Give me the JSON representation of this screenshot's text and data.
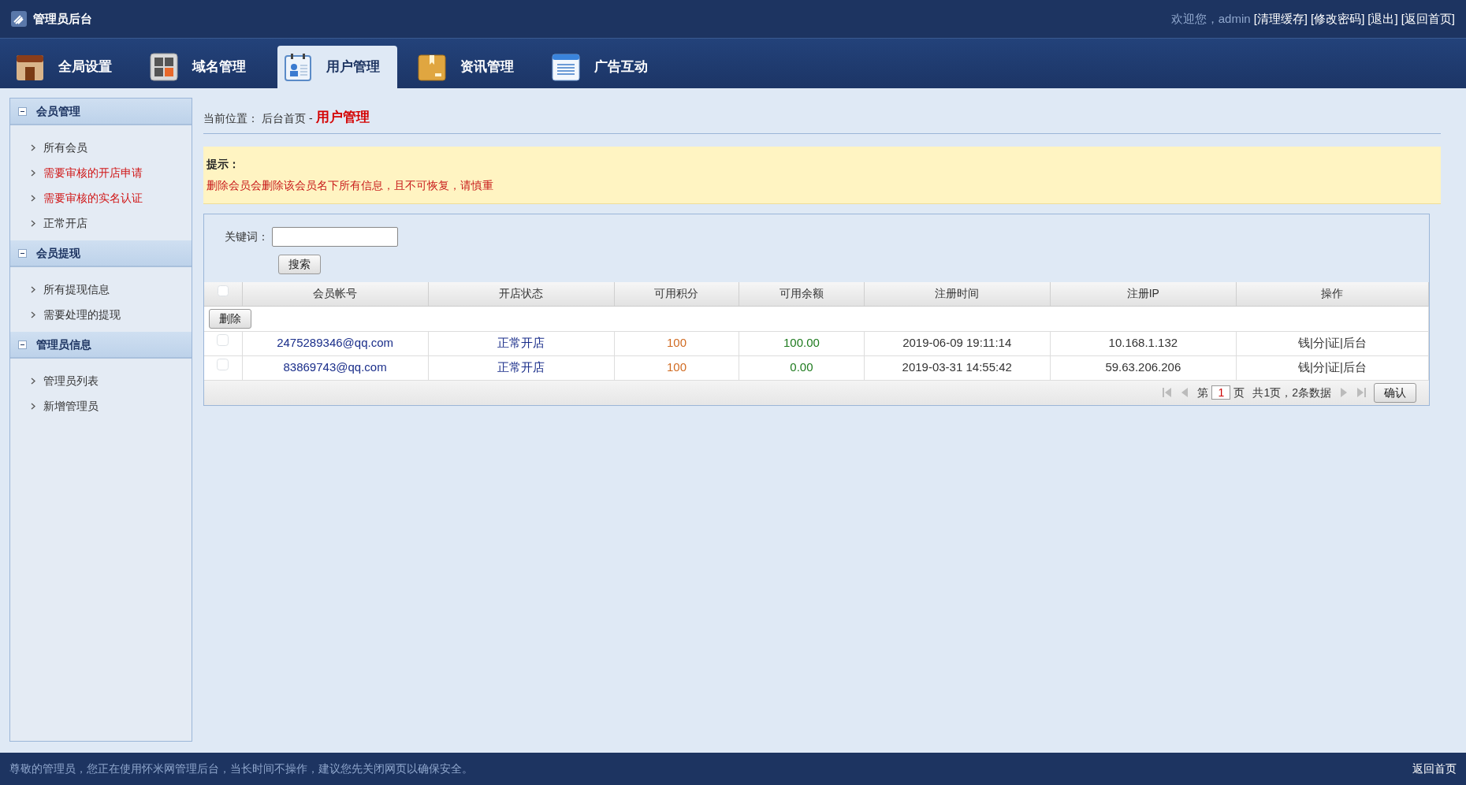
{
  "header": {
    "title": "管理员后台",
    "welcome": "欢迎您，admin",
    "links": [
      "[清理缓存]",
      "[修改密码]",
      "[退出]",
      "[返回首页]"
    ]
  },
  "tabs": [
    {
      "label": "全局设置",
      "selected": false
    },
    {
      "label": "域名管理",
      "selected": false
    },
    {
      "label": "用户管理",
      "selected": true
    },
    {
      "label": "资讯管理",
      "selected": false
    },
    {
      "label": "广告互动",
      "selected": false
    }
  ],
  "sidebar": {
    "groups": [
      {
        "title": "会员管理",
        "expanded": true,
        "items": [
          {
            "label": "所有会员",
            "alert": false
          },
          {
            "label": "需要审核的开店申请",
            "alert": true
          },
          {
            "label": "需要审核的实名认证",
            "alert": true
          },
          {
            "label": "正常开店",
            "alert": false
          }
        ]
      },
      {
        "title": "会员提现",
        "expanded": true,
        "items": [
          {
            "label": "所有提现信息",
            "alert": false
          },
          {
            "label": "需要处理的提现",
            "alert": false
          }
        ]
      },
      {
        "title": "管理员信息",
        "expanded": true,
        "items": [
          {
            "label": "管理员列表",
            "alert": false
          },
          {
            "label": "新增管理员",
            "alert": false
          }
        ]
      }
    ]
  },
  "breadcrumb": {
    "label": "当前位置：",
    "home": "后台首页",
    "separator": "-",
    "current": "用户管理"
  },
  "notice": {
    "title": "提示：",
    "text": "删除会员会删除该会员名下所有信息，且不可恢复，请慎重"
  },
  "search": {
    "label": "关键词：",
    "button": "搜索"
  },
  "table": {
    "select_all_checked": false,
    "columns": [
      "会员帐号",
      "开店状态",
      "可用积分",
      "可用余额",
      "注册时间",
      "注册IP",
      "操作"
    ],
    "delete_button": "删除",
    "rows": [
      {
        "checked": false,
        "cells": [
          "2475289346@qq.com",
          "正常开店",
          "100",
          "100.00",
          "2019-06-09 19:11:14",
          "10.168.1.132",
          "钱|分|证|后台"
        ]
      },
      {
        "checked": false,
        "cells": [
          "83869743@qq.com",
          "正常开店",
          "100",
          "0.00",
          "2019-03-31 14:55:42",
          "59.63.206.206",
          "钱|分|证|后台"
        ]
      }
    ]
  },
  "pager": {
    "prefix": "第",
    "page": "1",
    "suffix": "页",
    "summary": "共1页，2条数据",
    "confirm": "确认"
  },
  "footer": {
    "text": "尊敬的管理员，您正在使用怀米网管理后台，当长时间不操作，建议您先关闭网页以确保安全。",
    "link": "返回首页"
  }
}
